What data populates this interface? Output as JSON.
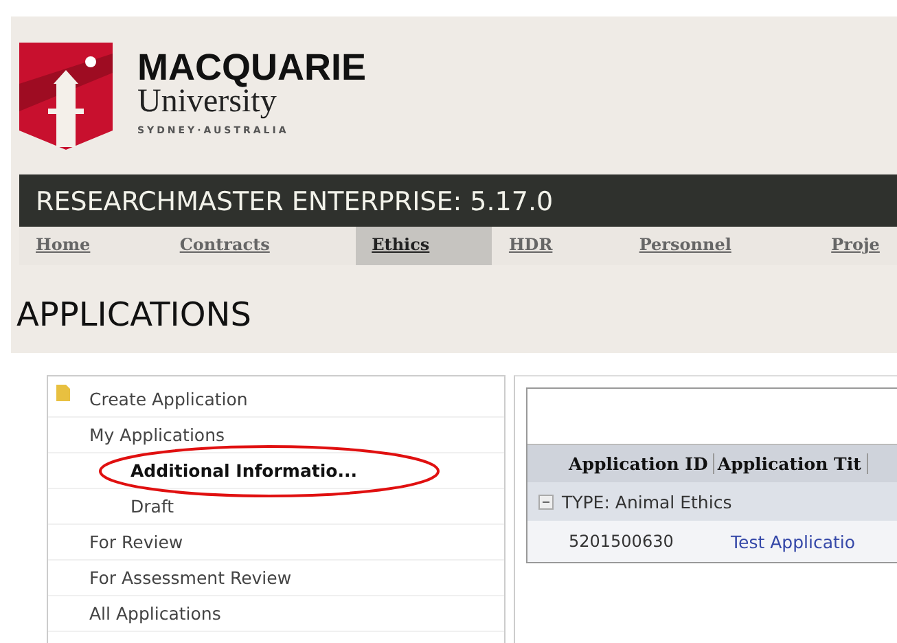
{
  "logo": {
    "name": "MACQUARIE",
    "subname": "University",
    "place": "SYDNEY·AUSTRALIA"
  },
  "product_bar": {
    "title": "RESEARCHMASTER ENTERPRISE: 5.17.0"
  },
  "tabs": [
    {
      "label": "Home",
      "selected": false
    },
    {
      "label": "Contracts",
      "selected": false
    },
    {
      "label": "Ethics",
      "selected": true
    },
    {
      "label": "HDR",
      "selected": false
    },
    {
      "label": "Personnel",
      "selected": false
    },
    {
      "label": "Proje",
      "selected": false
    }
  ],
  "page_title": "APPLICATIONS",
  "tree": [
    {
      "label": "Create Application",
      "kind": "action",
      "selected": false
    },
    {
      "label": "My Applications",
      "selected": false,
      "children": [
        {
          "label": "Additional Informatio...",
          "selected": true,
          "highlighted": true
        },
        {
          "label": "Draft",
          "selected": false
        }
      ]
    },
    {
      "label": "For Review",
      "selected": false
    },
    {
      "label": "For Assessment Review",
      "selected": false
    },
    {
      "label": "All Applications",
      "selected": false
    }
  ],
  "table": {
    "columns": [
      "Application ID",
      "Application Tit"
    ],
    "groups": [
      {
        "label": "TYPE: Animal Ethics",
        "expanded": true,
        "rows": [
          {
            "cells": [
              "5201500630",
              "Test Applicatio"
            ]
          }
        ]
      }
    ]
  }
}
